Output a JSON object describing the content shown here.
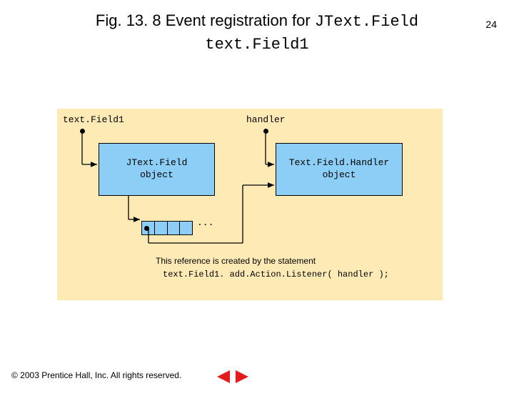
{
  "page_number": "24",
  "title": {
    "prefix": "Fig. 13. 8  Event registration for ",
    "code1": "JText.Field",
    "code2": "text.Field1"
  },
  "diagram": {
    "label_left": "text.Field1",
    "label_right": "handler",
    "box_left_line1": "JText.Field",
    "box_left_line2": "object",
    "box_right_line1": "Text.Field.Handler",
    "box_right_line2": "object",
    "ellipsis": "...",
    "caption_line1": "This reference is created by the statement",
    "caption_code": "text.Field1. add.Action.Listener( handler );"
  },
  "footer": "© 2003 Prentice Hall, Inc.  All rights reserved.",
  "colors": {
    "panel": "#feeab4",
    "box": "#8dcef7",
    "nav": "#e31b1b"
  }
}
